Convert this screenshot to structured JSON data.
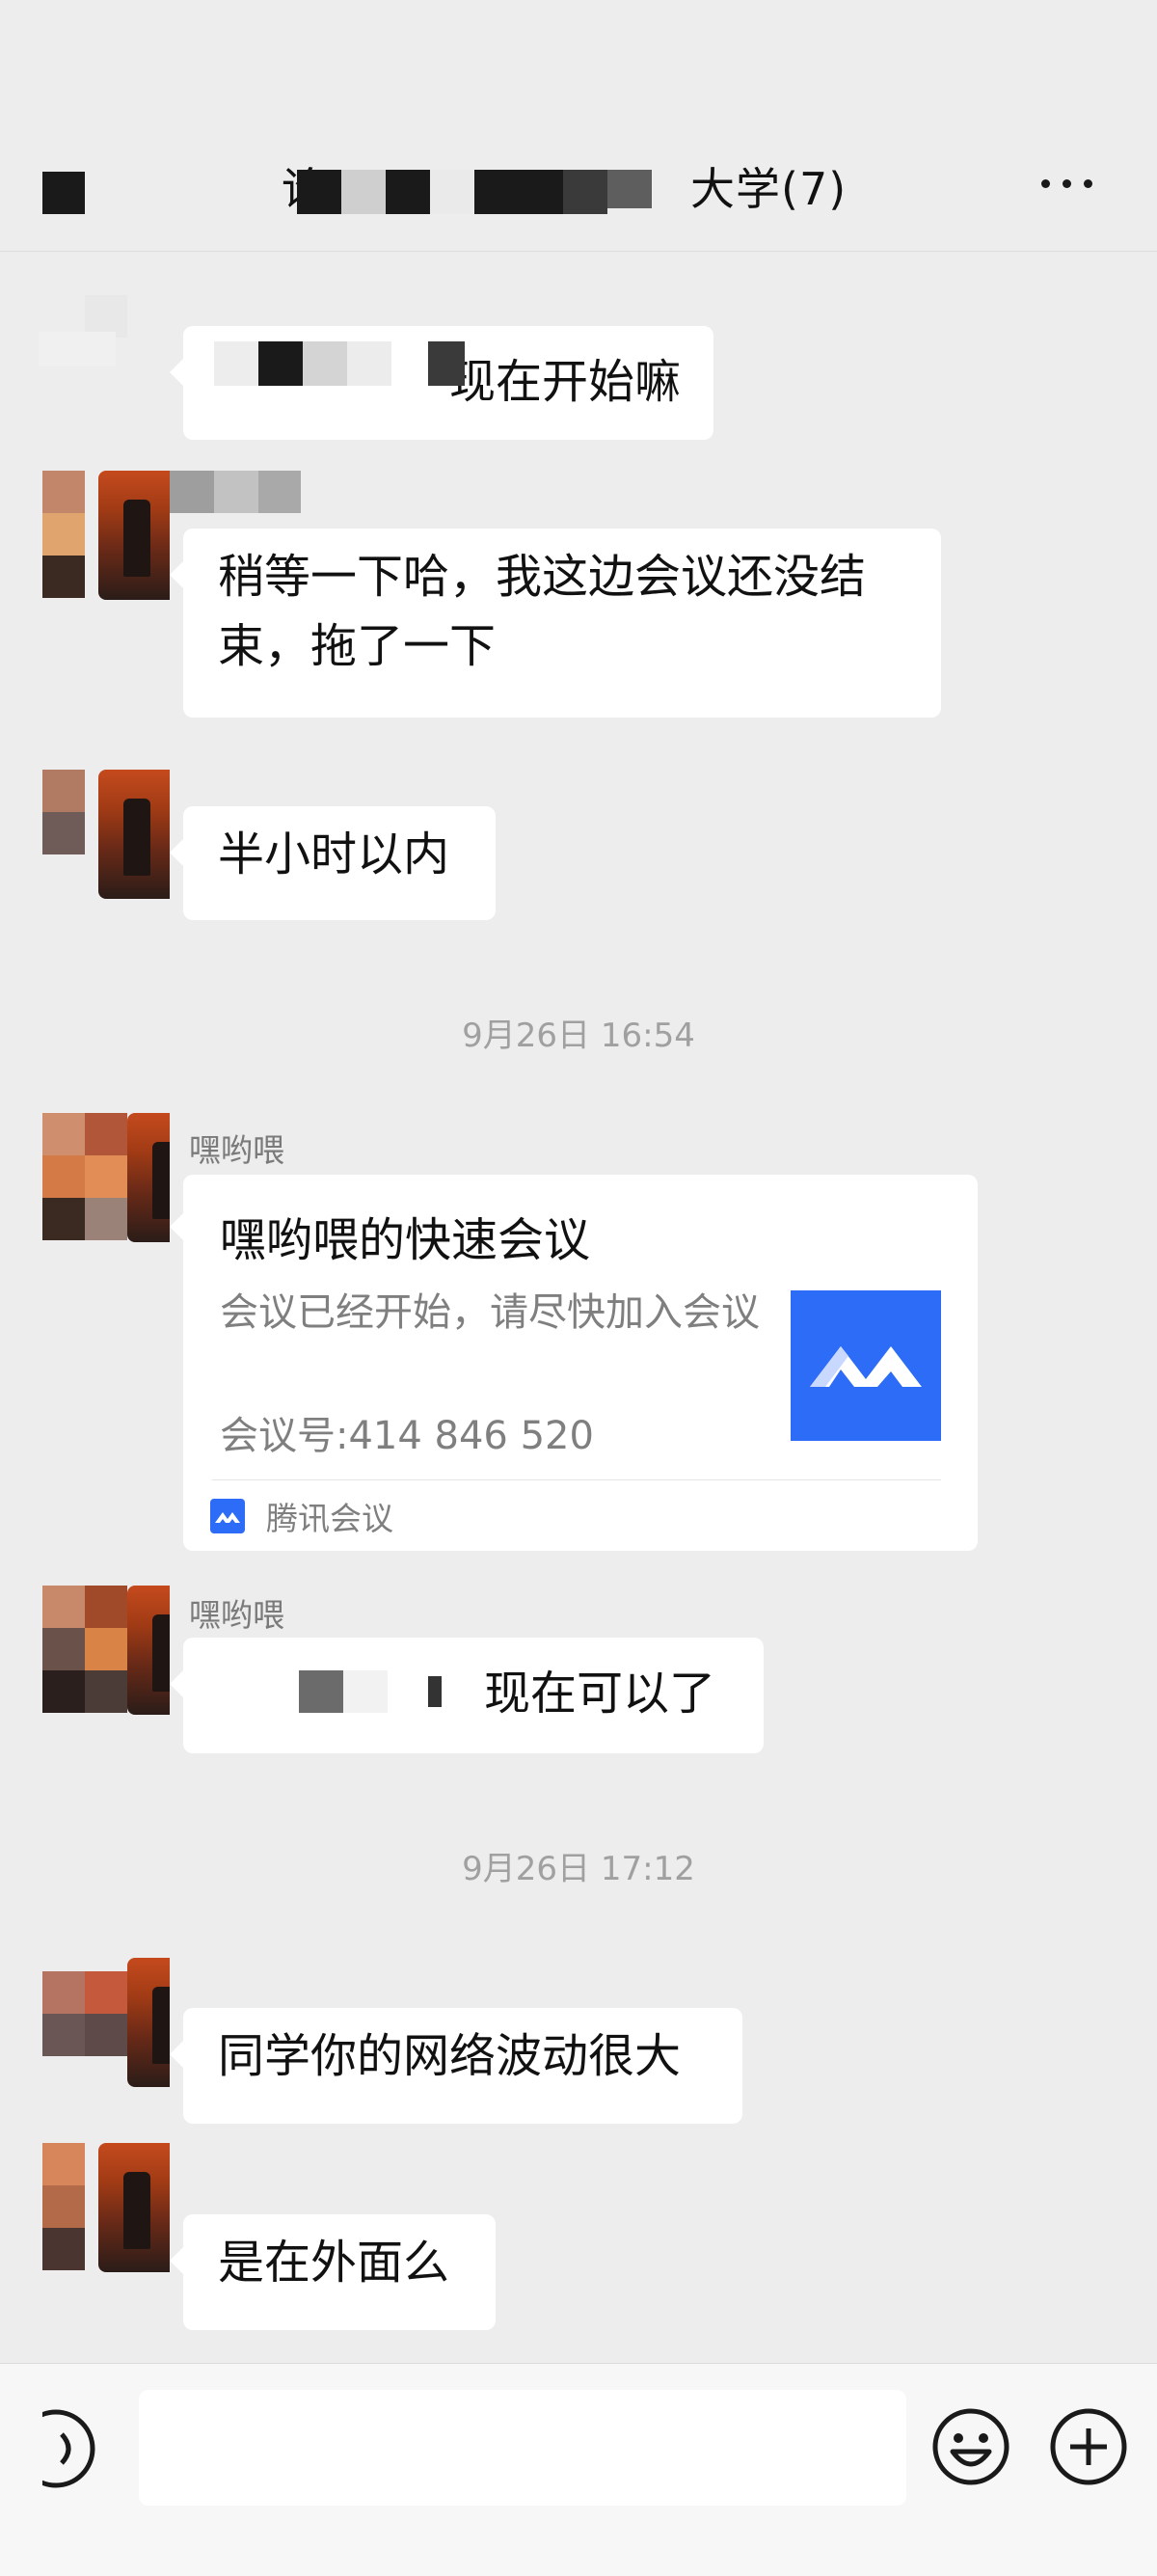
{
  "header": {
    "title_visible_fragment": "论",
    "title_suffix": "大学(7)",
    "back_icon": "back-arrow-icon",
    "more_icon": "more-dots-icon"
  },
  "messages": {
    "m1_text": "现在开始嘛",
    "m2_text": "稍等一下哈，我这边会议还没结束，拖了一下",
    "m3_text": "半小时以内",
    "ts1": "9月26日 16:54",
    "m4_sender": "嘿哟喂",
    "card": {
      "title": "嘿哟喂的快速会议",
      "desc": "会议已经开始，请尽快加入会议",
      "meeting_no": "会议号:414 846 520",
      "source": "腾讯会议",
      "source_icon": "tencent-meeting-icon"
    },
    "m5_sender": "嘿哟喂",
    "m5_text": "现在可以了",
    "ts2": "9月26日 17:12",
    "m6_text": "同学你的网络波动很大",
    "m7_text": "是在外面么"
  },
  "input_bar": {
    "voice_icon": "voice-icon",
    "emoji_icon": "emoji-icon",
    "plus_icon": "plus-icon"
  },
  "colors": {
    "background": "#ededed",
    "bubble": "#ffffff",
    "accent_blue": "#2d6cf6"
  }
}
